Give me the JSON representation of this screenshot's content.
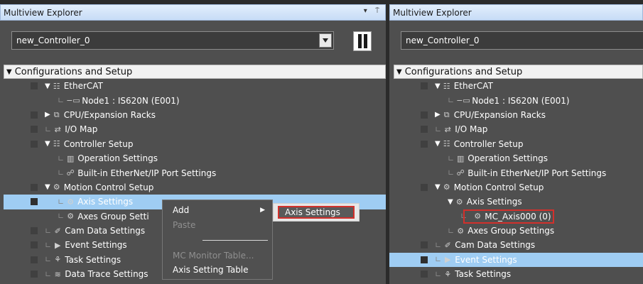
{
  "left": {
    "title": "Multiview Explorer",
    "title_controls": "▾ ⍑",
    "controller_select": "new_Controller_0",
    "section": "Configurations and Setup",
    "items": [
      {
        "label": "EtherCAT",
        "icon": "ethercat-icon",
        "glyph": "☷"
      },
      {
        "label": "Node1 : IS620N (E001)",
        "icon": "node-icon",
        "glyph": "−▭"
      },
      {
        "label": "CPU/Expansion Racks",
        "icon": "rack-icon",
        "glyph": "⧉"
      },
      {
        "label": "I/O Map",
        "icon": "io-map-icon",
        "glyph": "⇄"
      },
      {
        "label": "Controller Setup",
        "icon": "controller-setup-icon",
        "glyph": "☷"
      },
      {
        "label": "Operation Settings",
        "icon": "operation-settings-icon",
        "glyph": "▥"
      },
      {
        "label": "Built-in EtherNet/IP Port Settings",
        "icon": "ethernet-port-icon",
        "glyph": "☍"
      },
      {
        "label": "Motion Control Setup",
        "icon": "motion-control-icon",
        "glyph": "⚙"
      },
      {
        "label": "Axis Settings",
        "icon": "axis-settings-icon",
        "glyph": "⚙"
      },
      {
        "label": "Axes Group Setti",
        "icon": "axes-group-icon",
        "glyph": "⚙"
      },
      {
        "label": "Cam Data Settings",
        "icon": "cam-data-icon",
        "glyph": "✐"
      },
      {
        "label": "Event Settings",
        "icon": "event-flag-icon",
        "glyph": "▶"
      },
      {
        "label": "Task Settings",
        "icon": "task-settings-icon",
        "glyph": "⚘"
      },
      {
        "label": "Data Trace Settings",
        "icon": "data-trace-icon",
        "glyph": "≋"
      }
    ]
  },
  "context_menu": {
    "add": "Add",
    "paste": "Paste",
    "mc_monitor": "MC Monitor Table...",
    "axis_table": "Axis Setting Table",
    "submenu_axis": "Axis Settings"
  },
  "right": {
    "title": "Multiview Explorer",
    "controller_select": "new_Controller_0",
    "section": "Configurations and Setup",
    "items": [
      {
        "label": "EtherCAT",
        "icon": "ethercat-icon",
        "glyph": "☷"
      },
      {
        "label": "Node1 : IS620N (E001)",
        "icon": "node-icon",
        "glyph": "−▭"
      },
      {
        "label": "CPU/Expansion Racks",
        "icon": "rack-icon",
        "glyph": "⧉"
      },
      {
        "label": "I/O Map",
        "icon": "io-map-icon",
        "glyph": "⇄"
      },
      {
        "label": "Controller Setup",
        "icon": "controller-setup-icon",
        "glyph": "☷"
      },
      {
        "label": "Operation Settings",
        "icon": "operation-settings-icon",
        "glyph": "▥"
      },
      {
        "label": "Built-in EtherNet/IP Port Settings",
        "icon": "ethernet-port-icon",
        "glyph": "☍"
      },
      {
        "label": "Motion Control Setup",
        "icon": "motion-control-icon",
        "glyph": "⚙"
      },
      {
        "label": "Axis Settings",
        "icon": "axis-settings-icon",
        "glyph": "⚙"
      },
      {
        "label": "MC_Axis000 (0)",
        "icon": "axis-gear-icon",
        "glyph": "⚙"
      },
      {
        "label": "Axes Group Settings",
        "icon": "axes-group-icon",
        "glyph": "⚙"
      },
      {
        "label": "Cam Data Settings",
        "icon": "cam-data-icon",
        "glyph": "✐"
      },
      {
        "label": "Event Settings",
        "icon": "event-flag-icon",
        "glyph": "▶"
      },
      {
        "label": "Task Settings",
        "icon": "task-settings-icon",
        "glyph": "⚘"
      }
    ]
  }
}
